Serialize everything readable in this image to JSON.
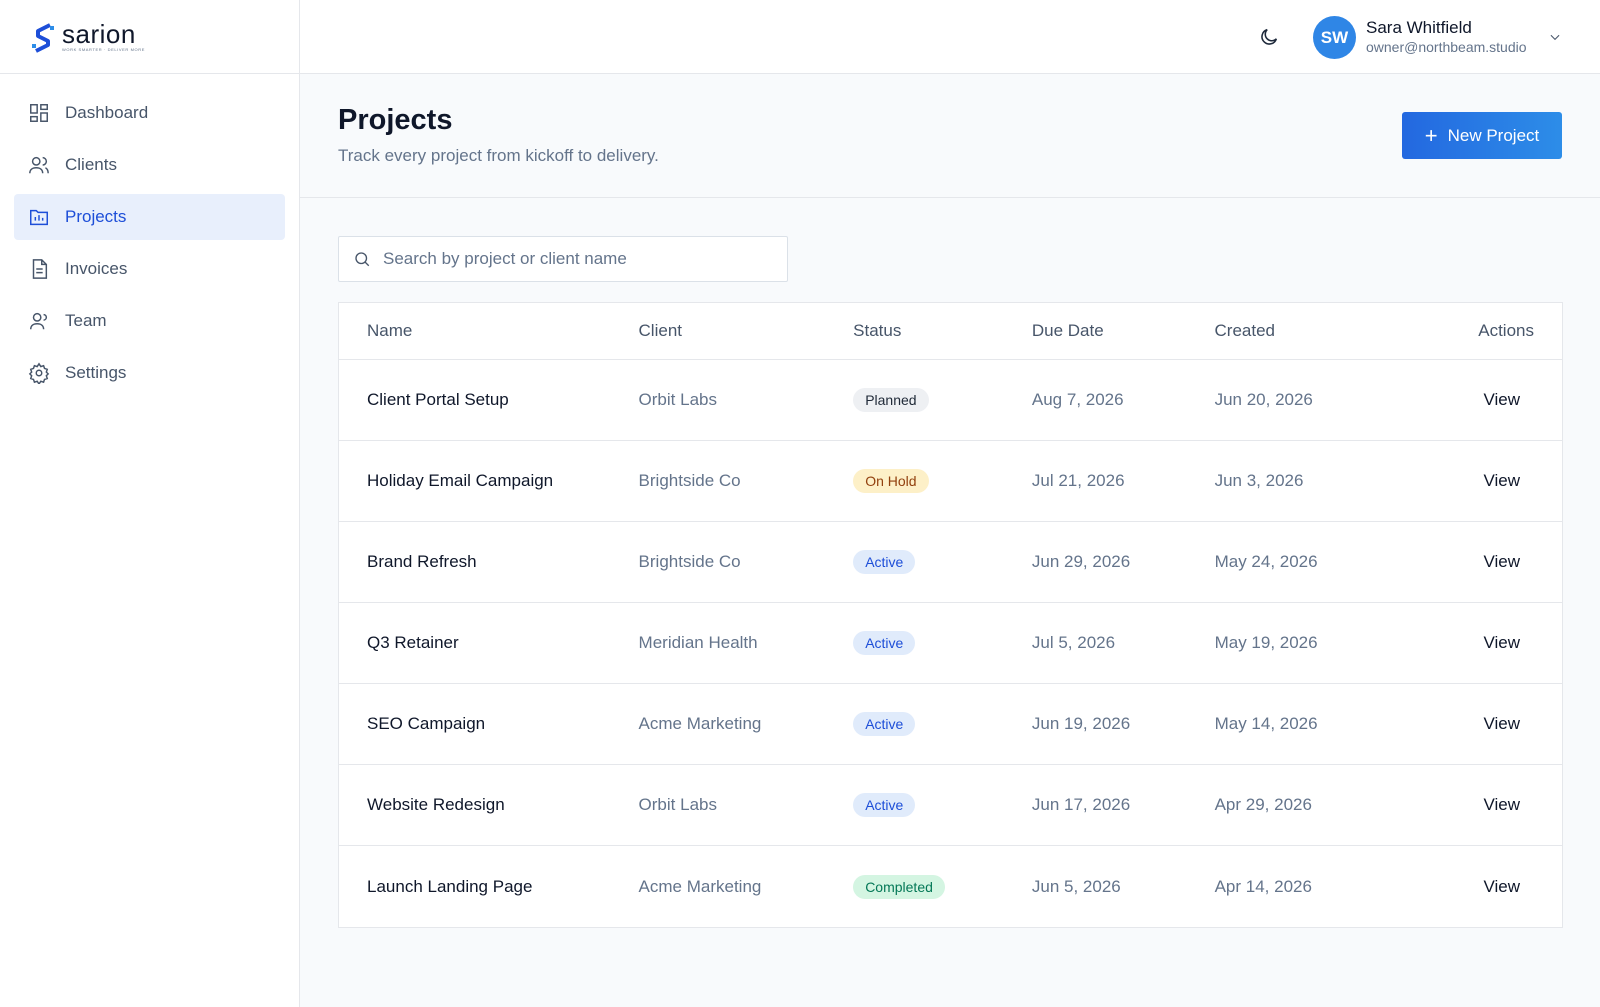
{
  "brand": {
    "name": "sarion",
    "tagline": "WORK SMARTER · DELIVER MORE",
    "colors": {
      "primary": "#1d4ed8",
      "accent": "#2d8de8"
    }
  },
  "sidebar": {
    "items": [
      {
        "label": "Dashboard",
        "icon": "grid-icon",
        "active": false
      },
      {
        "label": "Clients",
        "icon": "users-icon",
        "active": false
      },
      {
        "label": "Projects",
        "icon": "folder-chart-icon",
        "active": true
      },
      {
        "label": "Invoices",
        "icon": "document-icon",
        "active": false
      },
      {
        "label": "Team",
        "icon": "user-icon",
        "active": false
      },
      {
        "label": "Settings",
        "icon": "gear-icon",
        "active": false
      }
    ]
  },
  "topbar": {
    "theme_icon": "moon-icon",
    "user": {
      "initials": "SW",
      "name": "Sara Whitfield",
      "email": "owner@northbeam.studio"
    }
  },
  "header": {
    "title": "Projects",
    "subtitle": "Track every project from kickoff to delivery.",
    "new_button": "New Project"
  },
  "search": {
    "placeholder": "Search by project or client name",
    "value": ""
  },
  "table": {
    "columns": {
      "name": "Name",
      "client": "Client",
      "status": "Status",
      "due": "Due Date",
      "created": "Created",
      "actions": "Actions"
    },
    "action_label": "View",
    "rows": [
      {
        "name": "Client Portal Setup",
        "client": "Orbit Labs",
        "status": "Planned",
        "due": "Aug 7, 2026",
        "created": "Jun 20, 2026"
      },
      {
        "name": "Holiday Email Campaign",
        "client": "Brightside Co",
        "status": "On Hold",
        "due": "Jul 21, 2026",
        "created": "Jun 3, 2026"
      },
      {
        "name": "Brand Refresh",
        "client": "Brightside Co",
        "status": "Active",
        "due": "Jun 29, 2026",
        "created": "May 24, 2026"
      },
      {
        "name": "Q3 Retainer",
        "client": "Meridian Health",
        "status": "Active",
        "due": "Jul 5, 2026",
        "created": "May 19, 2026"
      },
      {
        "name": "SEO Campaign",
        "client": "Acme Marketing",
        "status": "Active",
        "due": "Jun 19, 2026",
        "created": "May 14, 2026"
      },
      {
        "name": "Website Redesign",
        "client": "Orbit Labs",
        "status": "Active",
        "due": "Jun 17, 2026",
        "created": "Apr 29, 2026"
      },
      {
        "name": "Launch Landing Page",
        "client": "Acme Marketing",
        "status": "Completed",
        "due": "Jun 5, 2026",
        "created": "Apr 14, 2026"
      }
    ]
  }
}
